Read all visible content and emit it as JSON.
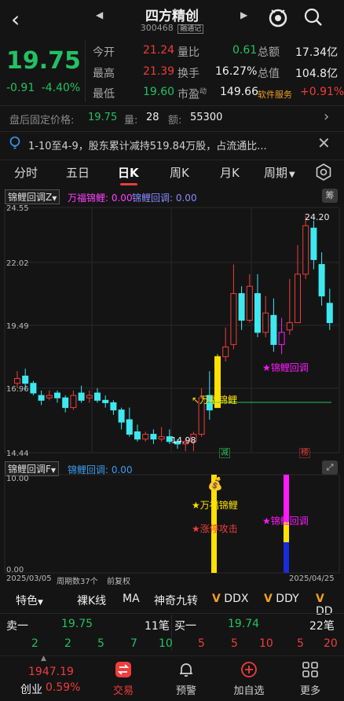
{
  "nav": {
    "back": "‹",
    "title": "四方精创",
    "code": "300468",
    "tag": "融通记",
    "prev": "◀",
    "next": "▶"
  },
  "quote": {
    "price": "19.75",
    "change": "-0.91",
    "change_pct": "-4.40%",
    "rows": [
      {
        "l1": "今开",
        "v1": "21.24",
        "l2": "量比",
        "v2": "0.61",
        "l3": "总额",
        "v3": "17.34亿"
      },
      {
        "l1": "最高",
        "v1": "21.39",
        "l2": "换手",
        "v2": "16.27%",
        "l3": "总值",
        "v3": "104.8亿"
      },
      {
        "l1": "最低",
        "v1": "19.60",
        "l2": "市盈",
        "l2_sup": "动",
        "v2": "149.66",
        "l3": "软件服务",
        "v3": "+0.91%"
      }
    ]
  },
  "after_hours": {
    "label": "盘后固定价格:",
    "price": "19.75",
    "vol_label": "量:",
    "vol": "28",
    "amt_label": "额:",
    "amt": "55300"
  },
  "announcement": {
    "text": "1-10至4-9，股东累计减持519.84万股，占流通比..."
  },
  "tabs": [
    "分时",
    "五日",
    "日K",
    "周K",
    "月K",
    "周期"
  ],
  "main_chart": {
    "indicator_button": "锦鲤回调Z",
    "legend1": "万福锦鲤: 0.00",
    "legend2": "锦鲤回调: 0.00",
    "corner_btn": "筹",
    "y_labels": [
      "24.55",
      "22.02",
      "19.49",
      "16.96",
      "14.44"
    ],
    "high_label": "24.20",
    "low_label": "14.98",
    "ann_wanfu": "↖万福锦鲤",
    "ann_jinli": "★锦鲤回调",
    "badge_jian": "减",
    "badge_bang": "榜"
  },
  "sub_chart": {
    "indicator_button": "锦鲤回调F",
    "legend": "锦鲤回调: 0.00",
    "y_top": "10.00",
    "y_bottom": "0.00",
    "ann_wanfu": "★万福锦鲤",
    "ann_zhangting": "★涨停攻击",
    "ann_jinli": "★锦鲤回调",
    "date_start": "2025/03/05",
    "period_info": "周期数37个",
    "fq": "前复权",
    "date_end": "2025/04/25"
  },
  "indicators": [
    "特色",
    "裸K线",
    "MA",
    "神奇九转",
    "DDX",
    "DDY",
    "DD"
  ],
  "book": {
    "sell_label": "卖一",
    "sell_price": "19.75",
    "sell_count": "11笔",
    "buy_label": "买一",
    "buy_price": "19.74",
    "buy_count": "22笔",
    "sell_qty": [
      "2",
      "2",
      "5",
      "7",
      "10"
    ],
    "buy_qty": [
      "5",
      "5",
      "10",
      "5",
      "20"
    ]
  },
  "bottom": {
    "index_value": "1947.19",
    "index_name": "创业",
    "index_pct": "0.59%",
    "items": [
      "交易",
      "预警",
      "加自选",
      "更多"
    ]
  },
  "colors": {
    "up": "#f03c3c",
    "down": "#23c163",
    "candle_down": "#3ee8f0",
    "candle_up": "#f03c3c",
    "yellow": "#ffe100",
    "magenta": "#ff19ff"
  }
}
